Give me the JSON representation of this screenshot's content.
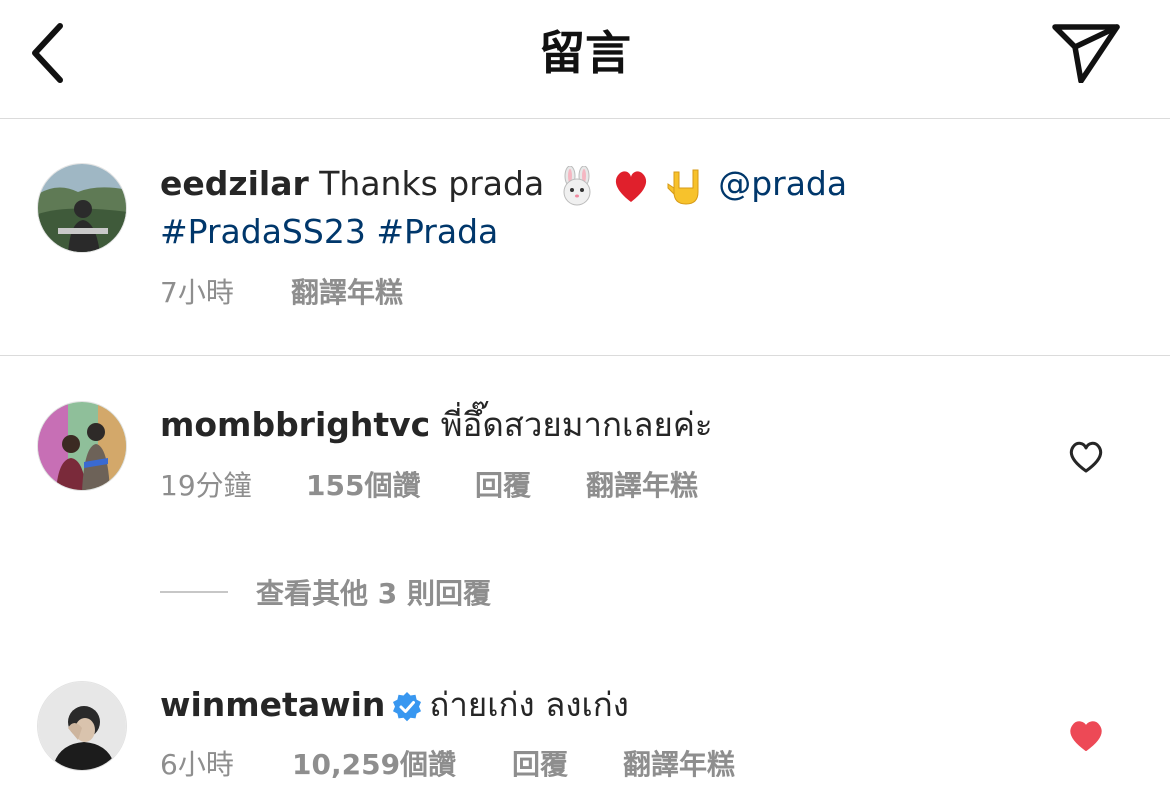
{
  "header": {
    "title": "留言",
    "back_icon": "chevron-left-icon",
    "share_icon": "paper-plane-icon"
  },
  "caption": {
    "username": "eedzilar",
    "text": "Thanks prada",
    "emojis": [
      "rabbit-face",
      "red-heart",
      "love-you-gesture"
    ],
    "mention": "@prada",
    "hashtags": [
      "#PradaSS23",
      "#Prada"
    ],
    "time": "7小時",
    "translate": "翻譯年糕"
  },
  "comments": [
    {
      "username": "mombbrightvc",
      "text": "พี่อึ๊ดสวยมากเลยค่ะ",
      "time": "19分鐘",
      "likes": "155個讚",
      "reply": "回覆",
      "translate": "翻譯年糕",
      "liked": false
    },
    {
      "username": "winmetawin",
      "verified": true,
      "text": "ถ่ายเก่ง ลงเก่ง",
      "time": "6小時",
      "likes": "10,259個讚",
      "reply": "回覆",
      "translate": "翻譯年糕",
      "liked": true
    }
  ],
  "view_replies": "查看其他 3 則回覆",
  "colors": {
    "text": "#262626",
    "secondary": "#8e8e8e",
    "link": "#00376b",
    "like_red": "#ed4956",
    "verified_blue": "#3897f0",
    "divider": "#dbdbdb"
  }
}
